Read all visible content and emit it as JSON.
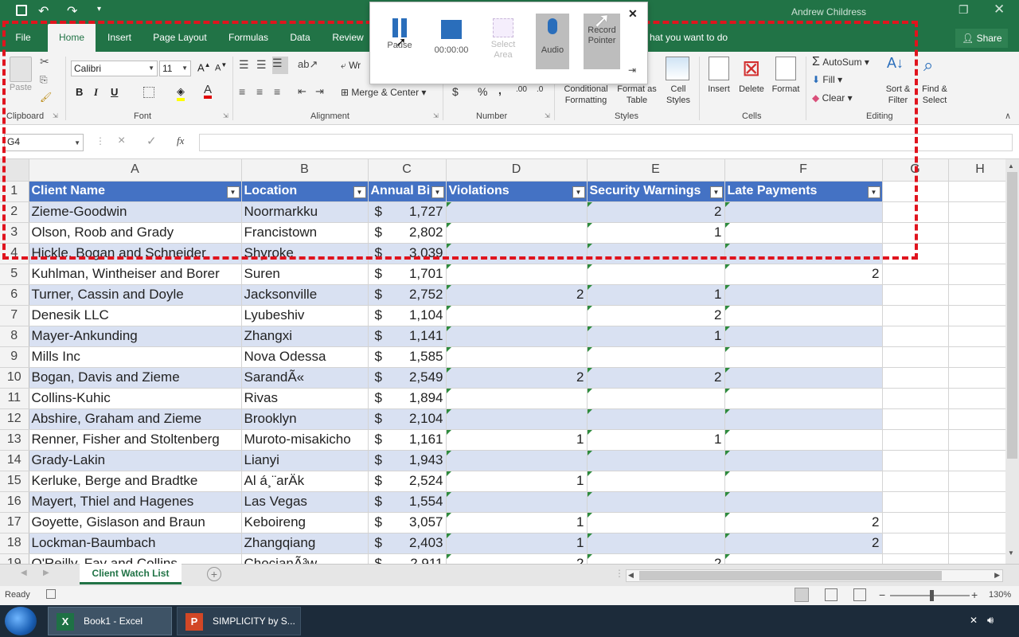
{
  "window": {
    "user": "Andrew Childress"
  },
  "tabs": [
    "File",
    "Home",
    "Insert",
    "Page Layout",
    "Formulas",
    "Data",
    "Review"
  ],
  "tell_me": "hat you want to do",
  "share_label": "Share",
  "ribbon": {
    "clipboard": {
      "paste": "Paste",
      "label": "Clipboard"
    },
    "font": {
      "name": "Calibri",
      "size": "11",
      "label": "Font",
      "bold": "B",
      "italic": "I",
      "underline": "U"
    },
    "alignment": {
      "wrap": "Wr",
      "merge": "Merge & Center",
      "label": "Alignment"
    },
    "number": {
      "currency": "$",
      "percent": "%",
      "comma": ",",
      "label": "Number"
    },
    "styles": {
      "conditional": "Conditional Formatting",
      "format_table": "Format as Table",
      "cell_styles": "Cell Styles",
      "label": "Styles"
    },
    "cells": {
      "insert": "Insert",
      "delete": "Delete",
      "format": "Format",
      "label": "Cells"
    },
    "editing": {
      "autosum": "AutoSum",
      "fill": "Fill",
      "clear": "Clear",
      "sort": "Sort & Filter",
      "find": "Find & Select",
      "label": "Editing"
    }
  },
  "formula_bar": {
    "name_box": "G4",
    "fx": "fx",
    "cancel": "×",
    "enter": "✓"
  },
  "columns": [
    "A",
    "B",
    "C",
    "D",
    "E",
    "F",
    "G",
    "H"
  ],
  "headers": [
    "Client Name",
    "Location",
    "Annual Bi",
    "Violations",
    "Security Warnings",
    "Late Payments"
  ],
  "rows": [
    {
      "n": "2",
      "name": "Zieme-Goodwin",
      "loc": "Noormarkku",
      "bill": "1,727",
      "v": "",
      "s": "2",
      "l": ""
    },
    {
      "n": "3",
      "name": "Olson, Roob and Grady",
      "loc": "Francistown",
      "bill": "2,802",
      "v": "",
      "s": "1",
      "l": ""
    },
    {
      "n": "4",
      "name": "Hickle, Bogan and Schneider",
      "loc": "Shyroke",
      "bill": "3,039",
      "v": "",
      "s": "",
      "l": ""
    },
    {
      "n": "5",
      "name": "Kuhlman, Wintheiser and Borer",
      "loc": "Suren",
      "bill": "1,701",
      "v": "",
      "s": "",
      "l": "2"
    },
    {
      "n": "6",
      "name": "Turner, Cassin and Doyle",
      "loc": "Jacksonville",
      "bill": "2,752",
      "v": "2",
      "s": "1",
      "l": ""
    },
    {
      "n": "7",
      "name": "Denesik LLC",
      "loc": "Lyubeshiv",
      "bill": "1,104",
      "v": "",
      "s": "2",
      "l": ""
    },
    {
      "n": "8",
      "name": "Mayer-Ankunding",
      "loc": "Zhangxi",
      "bill": "1,141",
      "v": "",
      "s": "1",
      "l": ""
    },
    {
      "n": "9",
      "name": "Mills Inc",
      "loc": "Nova Odessa",
      "bill": "1,585",
      "v": "",
      "s": "",
      "l": ""
    },
    {
      "n": "10",
      "name": "Bogan, Davis and Zieme",
      "loc": "SarandÃ«",
      "bill": "2,549",
      "v": "2",
      "s": "2",
      "l": ""
    },
    {
      "n": "11",
      "name": "Collins-Kuhic",
      "loc": "Rivas",
      "bill": "1,894",
      "v": "",
      "s": "",
      "l": ""
    },
    {
      "n": "12",
      "name": "Abshire, Graham and Zieme",
      "loc": "Brooklyn",
      "bill": "2,104",
      "v": "",
      "s": "",
      "l": ""
    },
    {
      "n": "13",
      "name": "Renner, Fisher and Stoltenberg",
      "loc": "Muroto-misakicho",
      "bill": "1,161",
      "v": "1",
      "s": "1",
      "l": ""
    },
    {
      "n": "14",
      "name": "Grady-Lakin",
      "loc": "Lianyi",
      "bill": "1,943",
      "v": "",
      "s": "",
      "l": ""
    },
    {
      "n": "15",
      "name": "Kerluke, Berge and Bradtke",
      "loc": "Al á¸¨arÄk",
      "bill": "2,524",
      "v": "1",
      "s": "",
      "l": ""
    },
    {
      "n": "16",
      "name": "Mayert, Thiel and Hagenes",
      "loc": "Las Vegas",
      "bill": "1,554",
      "v": "",
      "s": "",
      "l": ""
    },
    {
      "n": "17",
      "name": "Goyette, Gislason and Braun",
      "loc": "Keboireng",
      "bill": "3,057",
      "v": "1",
      "s": "",
      "l": "2"
    },
    {
      "n": "18",
      "name": "Lockman-Baumbach",
      "loc": "Zhangqiang",
      "bill": "2,403",
      "v": "1",
      "s": "",
      "l": "2"
    },
    {
      "n": "19",
      "name": "O'Reilly, Fay and Collins",
      "loc": "ChocianÃ³w",
      "bill": "2,911",
      "v": "2",
      "s": "2",
      "l": ""
    }
  ],
  "sheet_tab": "Client Watch List",
  "status": {
    "ready": "Ready",
    "zoom": "130%"
  },
  "recorder": {
    "pause": "Pause",
    "time": "00:00:00",
    "select_area": "Select Area",
    "audio": "Audio",
    "record_pointer": "Record Pointer"
  },
  "taskbar": [
    {
      "label": "Book1 - Excel"
    },
    {
      "label": "SIMPLICITY by S..."
    }
  ],
  "colors": {
    "excel_green": "#217346",
    "table_header": "#4472c4",
    "band": "#d9e1f2",
    "dashed": "#e0141e"
  }
}
